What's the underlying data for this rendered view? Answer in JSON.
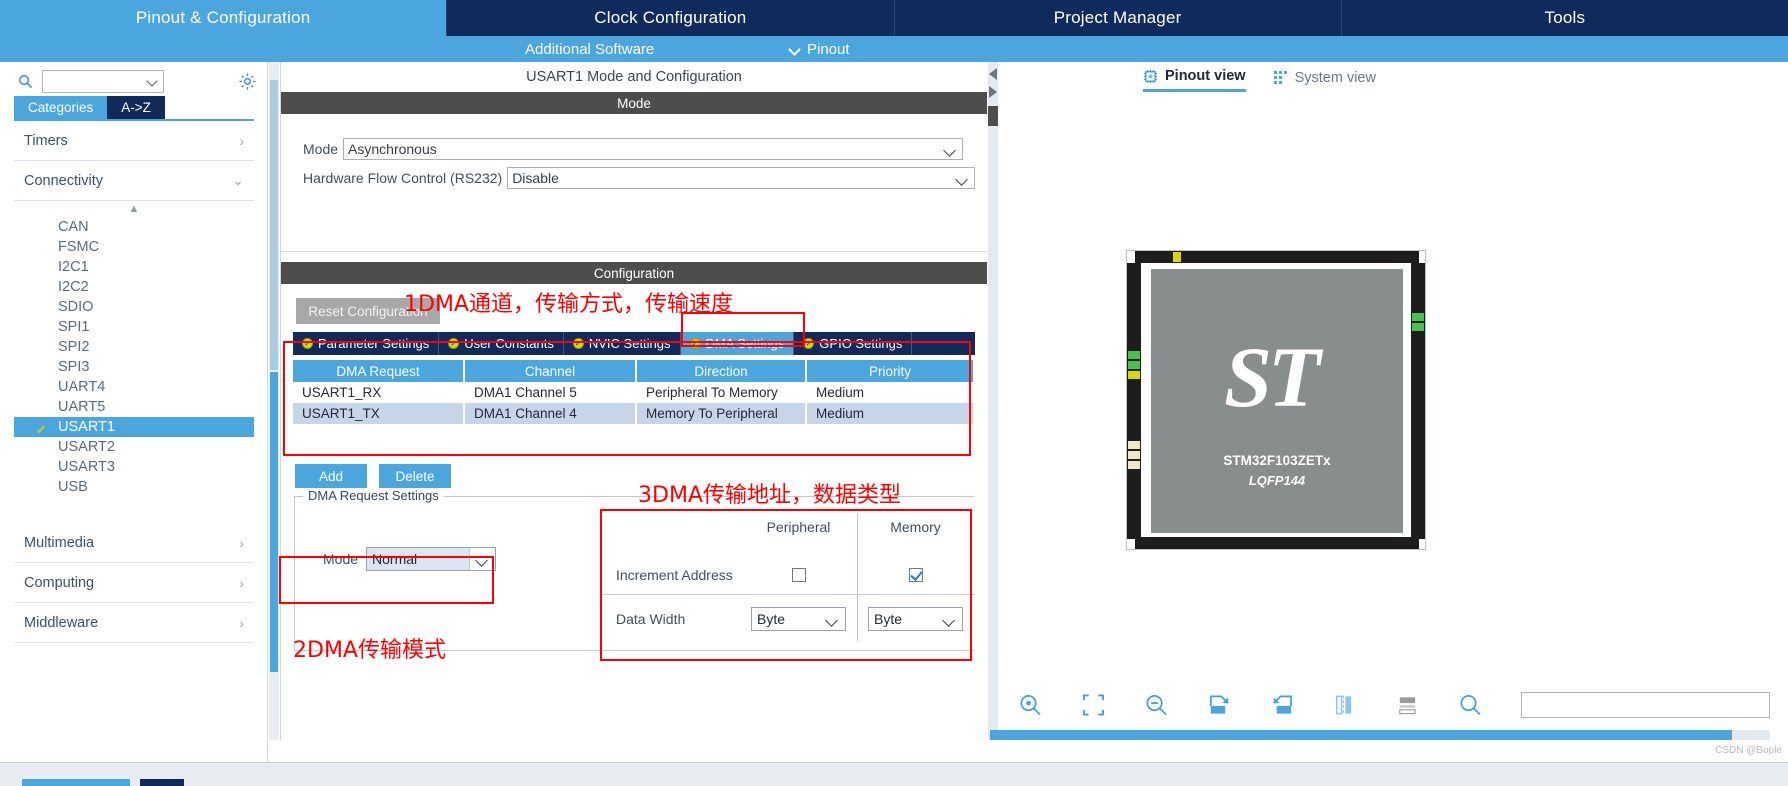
{
  "topnav": {
    "tabs": [
      {
        "label": "Pinout & Configuration",
        "active": true
      },
      {
        "label": "Clock Configuration",
        "active": false
      },
      {
        "label": "Project Manager",
        "active": false
      },
      {
        "label": "Tools",
        "active": false
      }
    ]
  },
  "subnav": {
    "additional_software": "Additional Software",
    "pinout": "Pinout"
  },
  "left_panel": {
    "search_value": "",
    "search_placeholder": "",
    "tabs": [
      {
        "label": "Categories",
        "active": true
      },
      {
        "label": "A->Z",
        "active": false
      }
    ],
    "groups": [
      {
        "label": "Timers",
        "expanded": false
      },
      {
        "label": "Connectivity",
        "expanded": true
      },
      {
        "label": "Multimedia",
        "expanded": false
      },
      {
        "label": "Computing",
        "expanded": false
      },
      {
        "label": "Middleware",
        "expanded": false
      }
    ],
    "connectivity_items": [
      {
        "label": "CAN",
        "selected": false
      },
      {
        "label": "FSMC",
        "selected": false
      },
      {
        "label": "I2C1",
        "selected": false
      },
      {
        "label": "I2C2",
        "selected": false
      },
      {
        "label": "SDIO",
        "selected": false
      },
      {
        "label": "SPI1",
        "selected": false
      },
      {
        "label": "SPI2",
        "selected": false
      },
      {
        "label": "SPI3",
        "selected": false
      },
      {
        "label": "UART4",
        "selected": false
      },
      {
        "label": "UART5",
        "selected": false
      },
      {
        "label": "USART1",
        "selected": true
      },
      {
        "label": "USART2",
        "selected": false
      },
      {
        "label": "USART3",
        "selected": false
      },
      {
        "label": "USB",
        "selected": false
      }
    ]
  },
  "middle_panel": {
    "title": "USART1 Mode and Configuration",
    "mode_header": "Mode",
    "mode_label": "Mode",
    "mode_value": "Asynchronous",
    "hw_flow_label": "Hardware Flow Control (RS232)",
    "hw_flow_value": "Disable",
    "configuration_header": "Configuration",
    "reset_button": "Reset Configuration",
    "config_tabs": [
      {
        "label": "Parameter Settings",
        "active": false
      },
      {
        "label": "User Constants",
        "active": false
      },
      {
        "label": "NVIC Settings",
        "active": false
      },
      {
        "label": "DMA Settings",
        "active": true
      },
      {
        "label": "GPIO Settings",
        "active": false
      }
    ],
    "dma_table": {
      "columns": [
        "DMA Request",
        "Channel",
        "Direction",
        "Priority"
      ],
      "rows": [
        [
          "USART1_RX",
          "DMA1 Channel 5",
          "Peripheral To Memory",
          "Medium"
        ],
        [
          "USART1_TX",
          "DMA1 Channel 4",
          "Memory To Peripheral",
          "Medium"
        ]
      ]
    },
    "add_button": "Add",
    "delete_button": "Delete",
    "request_settings": {
      "legend": "DMA Request Settings",
      "mode_label": "Mode",
      "mode_value": "Normal",
      "col_peripheral": "Peripheral",
      "col_memory": "Memory",
      "increment_address_label": "Increment Address",
      "increment_peripheral_checked": false,
      "increment_memory_checked": true,
      "data_width_label": "Data Width",
      "data_width_peripheral": "Byte",
      "data_width_memory": "Byte"
    }
  },
  "right_panel": {
    "view_tabs": [
      {
        "label": "Pinout view",
        "active": true,
        "icon": "chip-icon"
      },
      {
        "label": "System view",
        "active": false,
        "icon": "grid-icon"
      }
    ],
    "chip": {
      "name": "STM32F103ZETx",
      "package": "LQFP144",
      "vendor_logo": "st-logo"
    },
    "toolbar_icons": [
      "zoom-in-icon",
      "fit-to-screen-icon",
      "zoom-out-icon",
      "rotate-right-icon",
      "rotate-left-icon",
      "flip-horizontal-icon",
      "keep-user-placement-icon",
      "search-icon"
    ],
    "search_value": "",
    "watermark": "CSDN @Bople"
  },
  "annotations": [
    {
      "id": "ann1",
      "text": "1DMA通道，传输方式，传输速度"
    },
    {
      "id": "ann2",
      "text": "2DMA传输模式"
    },
    {
      "id": "ann3",
      "text": "3DMA传输地址，数据类型"
    }
  ],
  "colors": {
    "navy": "#112a5c",
    "accent_blue": "#4ba6dd",
    "dark_bar": "#4d4d4d",
    "annotation_red": "#ff0000",
    "row_alt": "#c7d5e8"
  }
}
